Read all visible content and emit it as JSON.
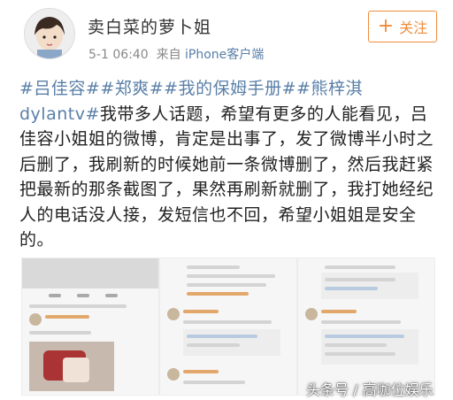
{
  "post": {
    "username": "卖白菜的萝卜姐",
    "time": "5-1 06:40",
    "source_prefix": "来自",
    "source": "iPhone客户端",
    "follow_label": "关注",
    "tags": "#吕佳容##郑爽##我的保姆手册##熊梓淇dylantv#",
    "body": "我带多人话题，希望有更多的人能看见，吕佳容小姐姐的微博，肯定是出事了，发了微博半小时之后删了，我刷新的时候她前一条微博删了，然后我赶紧把最新的那条截图了，果然再刷新就删了，我打她经纪人的电话没人接，发短信也不回，希望小姐姐是安全的。"
  },
  "screenshots": [
    {
      "name": "screenshot-profile-post"
    },
    {
      "name": "screenshot-comments-1"
    },
    {
      "name": "screenshot-comments-2"
    }
  ],
  "watermark": "头条号 / 高咖位娱乐",
  "colors": {
    "accent": "#f08c3a",
    "link": "#5a7fa8"
  }
}
